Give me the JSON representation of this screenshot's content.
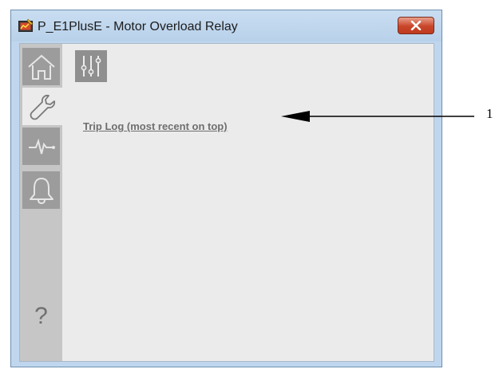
{
  "window": {
    "title": "P_E1PlusE - Motor Overload Relay",
    "app_icon": "faceplate-app-icon",
    "close_icon": "close-x-icon"
  },
  "nav": {
    "items": [
      {
        "name": "home",
        "icon": "home-icon",
        "state": "normal"
      },
      {
        "name": "maintenance",
        "icon": "wrench-icon",
        "state": "selected"
      },
      {
        "name": "trends",
        "icon": "trend-pulse-icon",
        "state": "normal"
      },
      {
        "name": "alarms",
        "icon": "bell-icon",
        "state": "normal"
      }
    ],
    "help_label": "?"
  },
  "content": {
    "subtab_icon": "sliders-icon",
    "trip_log_link": "Trip Log (most recent on top)"
  },
  "callout": {
    "label": "1"
  },
  "colors": {
    "titlebar": "#bfd6ee",
    "nav_background": "#c6c6c6",
    "nav_button": "#9c9c9c",
    "content_background": "#ebebeb",
    "close_button": "#c9462a"
  }
}
